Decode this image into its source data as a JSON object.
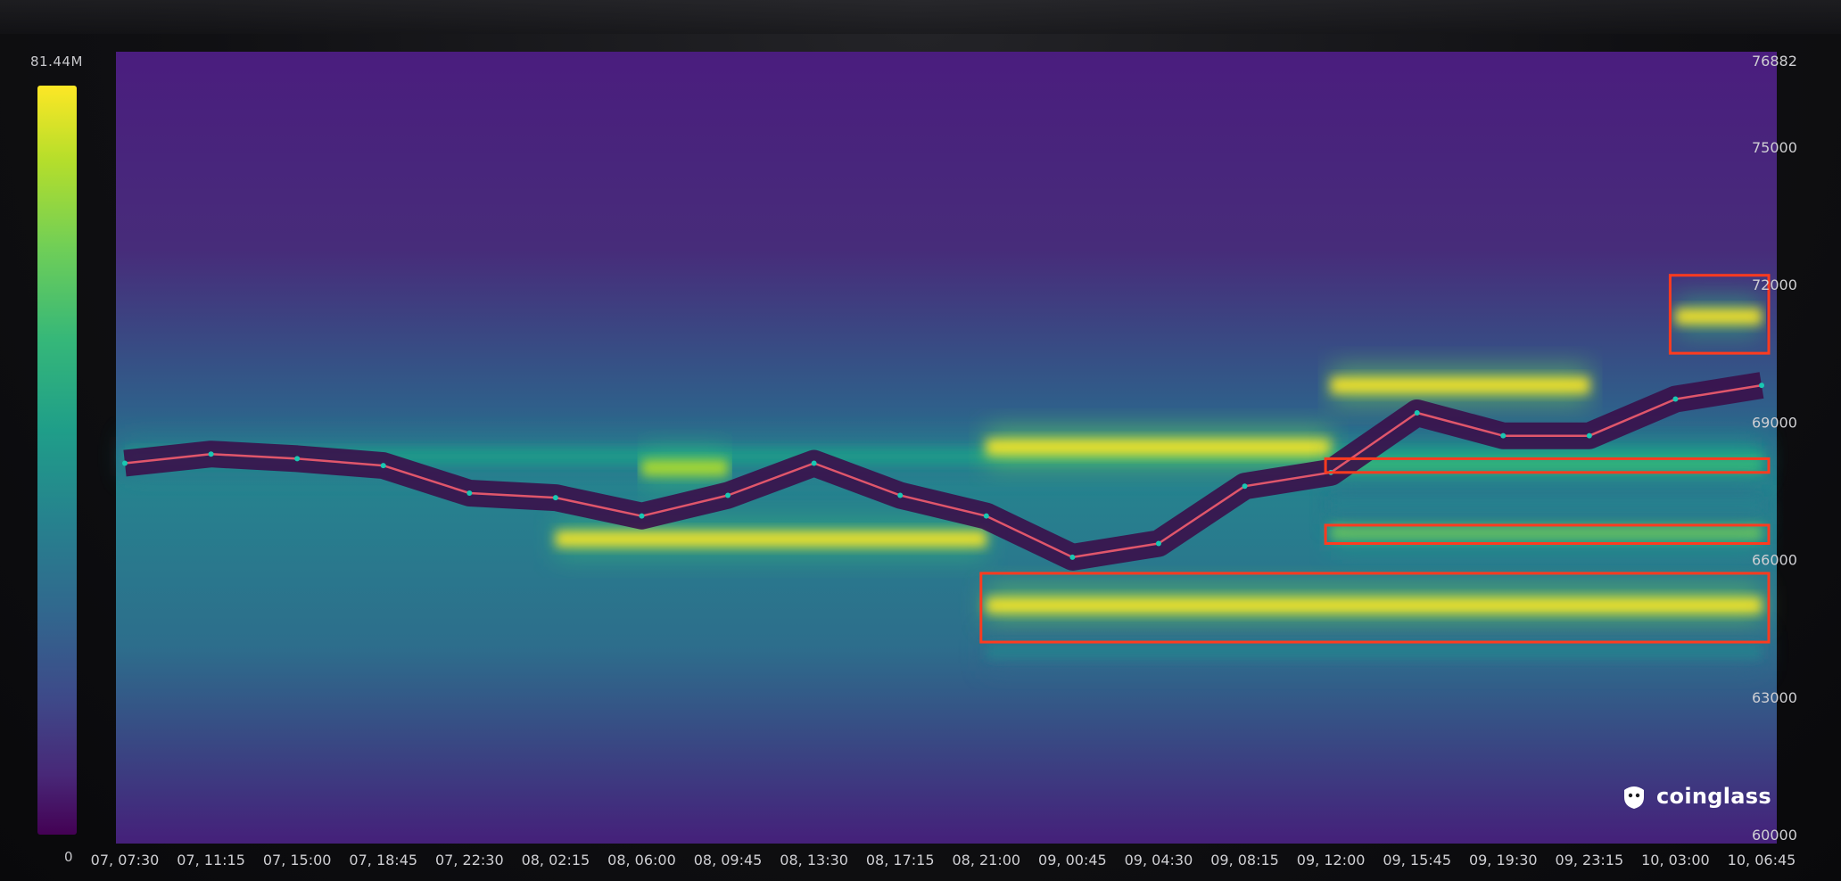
{
  "brand": {
    "name": "coinglass"
  },
  "colorbar": {
    "max_label": "81.44M",
    "min_label": "0",
    "colors": [
      "#fde725",
      "#b5de2b",
      "#6ece58",
      "#35b779",
      "#1f9e89",
      "#26828e",
      "#31688e",
      "#3e4989",
      "#482878",
      "#440154"
    ]
  },
  "highlight_color": "#ff3b1f",
  "chart_data": {
    "type": "heatmap",
    "title": "",
    "xlabel": "",
    "ylabel": "",
    "ylim": [
      60000,
      76882
    ],
    "y_tick_labels": [
      "76882",
      "75000",
      "72000",
      "69000",
      "66000",
      "63000",
      "60000"
    ],
    "y_tick_values": [
      76882,
      75000,
      72000,
      69000,
      66000,
      63000,
      60000
    ],
    "x_tick_labels": [
      "07, 07:30",
      "07, 11:15",
      "07, 15:00",
      "07, 18:45",
      "07, 22:30",
      "08, 02:15",
      "08, 06:00",
      "08, 09:45",
      "08, 13:30",
      "08, 17:15",
      "08, 21:00",
      "09, 00:45",
      "09, 04:30",
      "09, 08:15",
      "09, 12:00",
      "09, 15:45",
      "09, 19:30",
      "09, 23:15",
      "10, 03:00",
      "10, 06:45"
    ],
    "price_series": {
      "name": "",
      "x": [
        "07, 07:30",
        "07, 11:15",
        "07, 15:00",
        "07, 18:45",
        "07, 22:30",
        "08, 02:15",
        "08, 06:00",
        "08, 09:45",
        "08, 13:30",
        "08, 17:15",
        "08, 21:00",
        "09, 00:45",
        "09, 04:30",
        "09, 08:15",
        "09, 12:00",
        "09, 15:45",
        "09, 19:30",
        "09, 23:15",
        "10, 03:00",
        "10, 06:45"
      ],
      "y": [
        68100,
        68300,
        68200,
        68050,
        67450,
        67350,
        66950,
        67400,
        68100,
        67400,
        66950,
        66050,
        66350,
        67600,
        67900,
        69200,
        68700,
        68700,
        69500,
        69800
      ]
    },
    "liquidity_bands": [
      {
        "price": 68250,
        "start": "07, 07:30",
        "end": "10, 06:45",
        "intensity": 0.55
      },
      {
        "price": 66450,
        "start": "08, 02:15",
        "end": "08, 21:00",
        "intensity": 0.95
      },
      {
        "price": 68000,
        "start": "08, 06:00",
        "end": "08, 09:45",
        "intensity": 0.85
      },
      {
        "price": 68450,
        "start": "08, 21:00",
        "end": "09, 12:00",
        "intensity": 1.0
      },
      {
        "price": 69800,
        "start": "09, 12:00",
        "end": "09, 23:15",
        "intensity": 1.0
      },
      {
        "price": 65000,
        "start": "08, 21:00",
        "end": "10, 06:45",
        "intensity": 1.0
      },
      {
        "price": 71300,
        "start": "10, 03:00",
        "end": "10, 06:45",
        "intensity": 0.95
      },
      {
        "price": 68050,
        "start": "09, 12:00",
        "end": "10, 06:45",
        "intensity": 0.7
      },
      {
        "price": 66600,
        "start": "09, 12:00",
        "end": "10, 06:45",
        "intensity": 0.75
      },
      {
        "price": 64000,
        "start": "08, 21:00",
        "end": "10, 06:45",
        "intensity": 0.5
      },
      {
        "price": 67200,
        "start": "09, 12:00",
        "end": "10, 06:45",
        "intensity": 0.5
      }
    ],
    "highlight_boxes": [
      {
        "y_from": 70500,
        "y_to": 72200,
        "x_from": "10, 03:00",
        "x_to": "10, 06:45"
      },
      {
        "y_from": 67900,
        "y_to": 68200,
        "x_from": "09, 12:00",
        "x_to": "10, 06:45"
      },
      {
        "y_from": 66350,
        "y_to": 66750,
        "x_from": "09, 12:00",
        "x_to": "10, 06:45"
      },
      {
        "y_from": 64200,
        "y_to": 65700,
        "x_from": "08, 21:00",
        "x_to": "10, 06:45"
      }
    ],
    "grid": false,
    "legend": "none"
  }
}
